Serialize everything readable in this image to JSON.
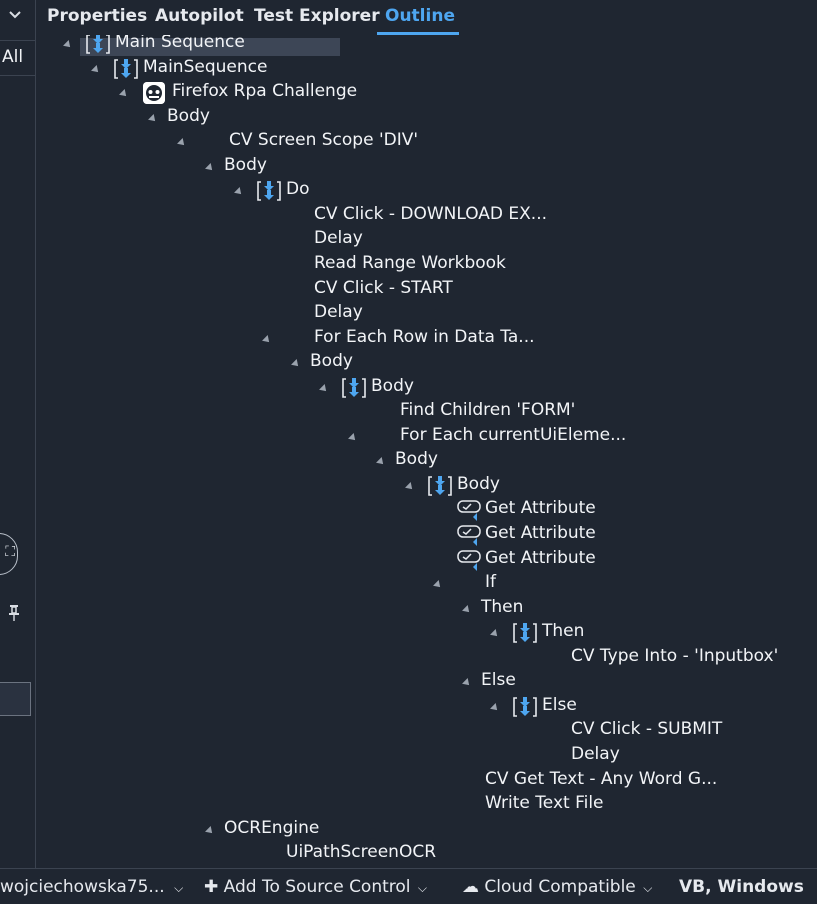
{
  "tabs": [
    {
      "label": "Properties",
      "active": false
    },
    {
      "label": "Autopilot",
      "active": false
    },
    {
      "label": "Test Explorer",
      "active": false
    },
    {
      "label": "Outline",
      "active": true
    }
  ],
  "left_panel": {
    "filter_label": "All"
  },
  "outline": {
    "nodes": [
      {
        "label": "Main Sequence",
        "icon": "sequence-icon",
        "expander": true,
        "selected": true
      },
      {
        "label": "MainSequence",
        "icon": "sequence-icon",
        "expander": true
      },
      {
        "label": "Firefox Rpa Challenge",
        "icon": "robot-icon",
        "expander": true
      },
      {
        "label": "Body",
        "expander": true
      },
      {
        "label": "CV Screen Scope 'DIV'",
        "expander": true
      },
      {
        "label": "Body",
        "expander": true
      },
      {
        "label": "Do",
        "icon": "sequence-icon",
        "expander": true
      },
      {
        "label": "CV Click - DOWNLOAD EX..."
      },
      {
        "label": "Delay"
      },
      {
        "label": "Read Range Workbook"
      },
      {
        "label": "CV Click - START"
      },
      {
        "label": "Delay"
      },
      {
        "label": "For Each Row in Data Ta...",
        "expander": true
      },
      {
        "label": "Body",
        "expander": true
      },
      {
        "label": "Body",
        "icon": "sequence-icon",
        "expander": true
      },
      {
        "label": "Find Children 'FORM'"
      },
      {
        "label": "For Each currentUiEleme...",
        "expander": true
      },
      {
        "label": "Body",
        "expander": true
      },
      {
        "label": "Body",
        "icon": "sequence-icon",
        "expander": true
      },
      {
        "label": "Get Attribute",
        "icon": "get-attribute-icon"
      },
      {
        "label": "Get Attribute",
        "icon": "get-attribute-icon"
      },
      {
        "label": "Get Attribute",
        "icon": "get-attribute-icon"
      },
      {
        "label": "If",
        "expander": true
      },
      {
        "label": "Then",
        "expander": true
      },
      {
        "label": "Then",
        "icon": "sequence-icon",
        "expander": true
      },
      {
        "label": "CV Type Into - 'Inputbox'"
      },
      {
        "label": "Else",
        "expander": true
      },
      {
        "label": "Else",
        "icon": "sequence-icon",
        "expander": true
      },
      {
        "label": "CV Click - SUBMIT"
      },
      {
        "label": "Delay"
      },
      {
        "label": "CV Get Text - Any Word G..."
      },
      {
        "label": "Write Text File"
      },
      {
        "label": "OCREngine",
        "expander": true
      },
      {
        "label": "UiPathScreenOCR"
      }
    ]
  },
  "status_bar": {
    "user": "wojciechowska75...",
    "source_control": "Add To Source Control",
    "cloud": "Cloud Compatible",
    "language": "VB, Windows"
  },
  "colors": {
    "background": "#1f2631",
    "accent": "#4ea6f0",
    "text": "#f2f4f7"
  }
}
